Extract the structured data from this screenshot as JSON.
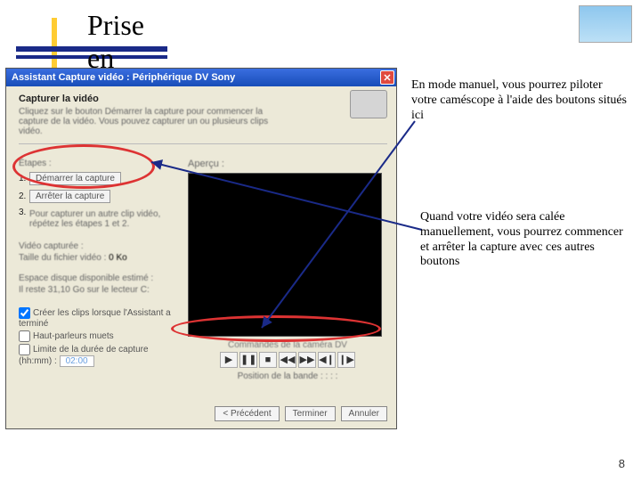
{
  "title": "Prise en main",
  "logo_caption": "",
  "window": {
    "title": "Assistant Capture vidéo : Périphérique DV Sony",
    "close": "✕",
    "section": "Capturer la vidéo",
    "desc": "Cliquez sur le bouton Démarrer la capture pour commencer la capture de la vidéo. Vous pouvez capturer un ou plusieurs clips vidéo.",
    "steps_label": "Étapes :",
    "preview_label": "Aperçu :",
    "btn_start": "Démarrer la capture",
    "btn_stop": "Arrêter la capture",
    "step3": "Pour capturer un autre clip vidéo, répétez les étapes 1 et 2.",
    "captured_label": "Vidéo capturée :",
    "size_label": "Taille du fichier vidéo :",
    "size_val": "0 Ko",
    "disk_label": "Espace disque disponible estimé :",
    "disk_val": "Il reste 31,10 Go sur le lecteur C:",
    "chk1": "Créer les clips lorsque l'Assistant a terminé",
    "chk2": "Haut-parleurs muets",
    "chk3": "Limite de la durée de capture (hh:mm) :",
    "timebox": "02:00",
    "dv_label": "Commandes de la caméra DV",
    "tape_label": "Position de la bande :   : : :",
    "btn_prev": "< Précédent",
    "btn_finish": "Terminer",
    "btn_cancel": "Annuler"
  },
  "anno1": "En mode manuel, vous pourrez piloter votre caméscope à l'aide des boutons situés ici",
  "anno2": "Quand votre vidéo sera calée manuellement, vous pourrez commencer et arrêter la capture avec ces autres boutons",
  "pagenum": "8"
}
